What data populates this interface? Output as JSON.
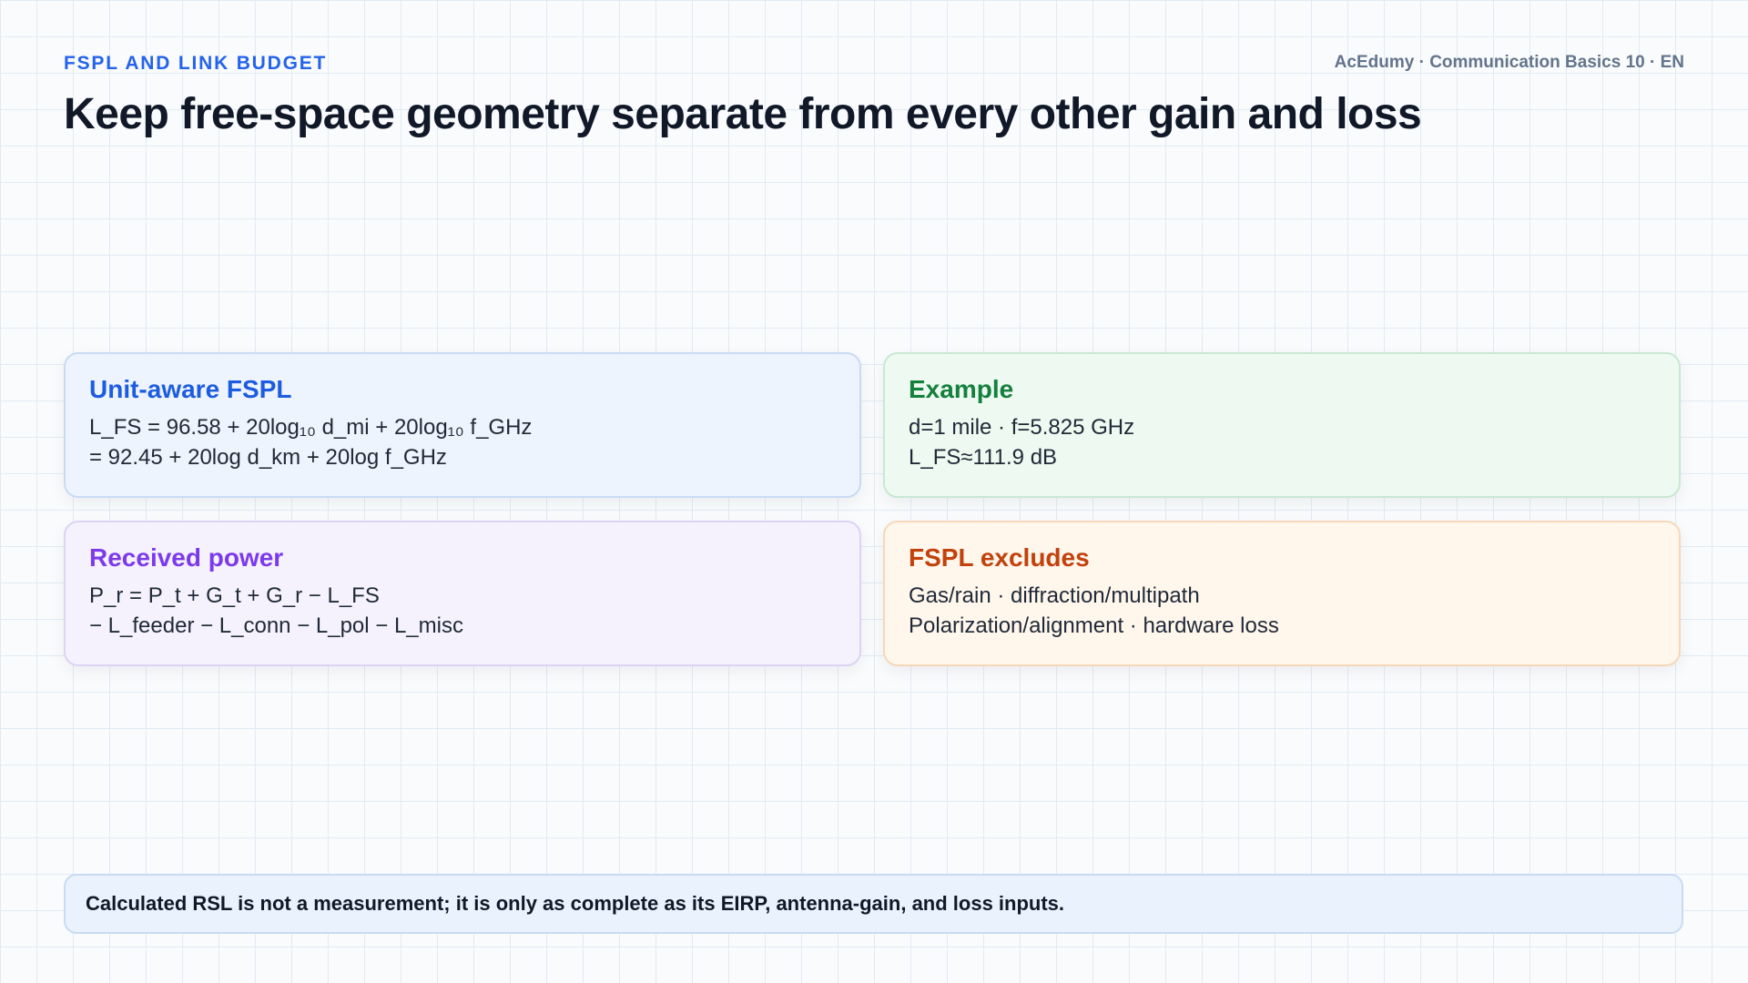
{
  "header": {
    "kicker": "FSPL AND LINK BUDGET",
    "meta": "AcEdumy · Communication Basics 10 · EN",
    "title": "Keep free-space geometry separate from every other gain and loss"
  },
  "cards": [
    {
      "title": "Unit-aware FSPL",
      "lines": [
        "L_FS = 96.58 + 20log₁₀ d_mi + 20log₁₀ f_GHz",
        "= 92.45 + 20log d_km + 20log f_GHz"
      ],
      "accent": "#1d5ce0"
    },
    {
      "title": "Example",
      "lines": [
        "d=1 mile · f=5.825 GHz",
        "L_FS≈111.9 dB"
      ],
      "accent": "#15803d"
    },
    {
      "title": "Received power",
      "lines": [
        "P_r = P_t + G_t + G_r − L_FS",
        "− L_feeder − L_conn − L_pol − L_misc"
      ],
      "accent": "#7c3aed"
    },
    {
      "title": "FSPL excludes",
      "lines": [
        "Gas/rain · diffraction/multipath",
        "Polarization/alignment · hardware loss"
      ],
      "accent": "#c2410c"
    }
  ],
  "footer": {
    "note": "Calculated RSL is not a measurement; it is only as complete as its EIRP, antenna-gain, and loss inputs."
  }
}
